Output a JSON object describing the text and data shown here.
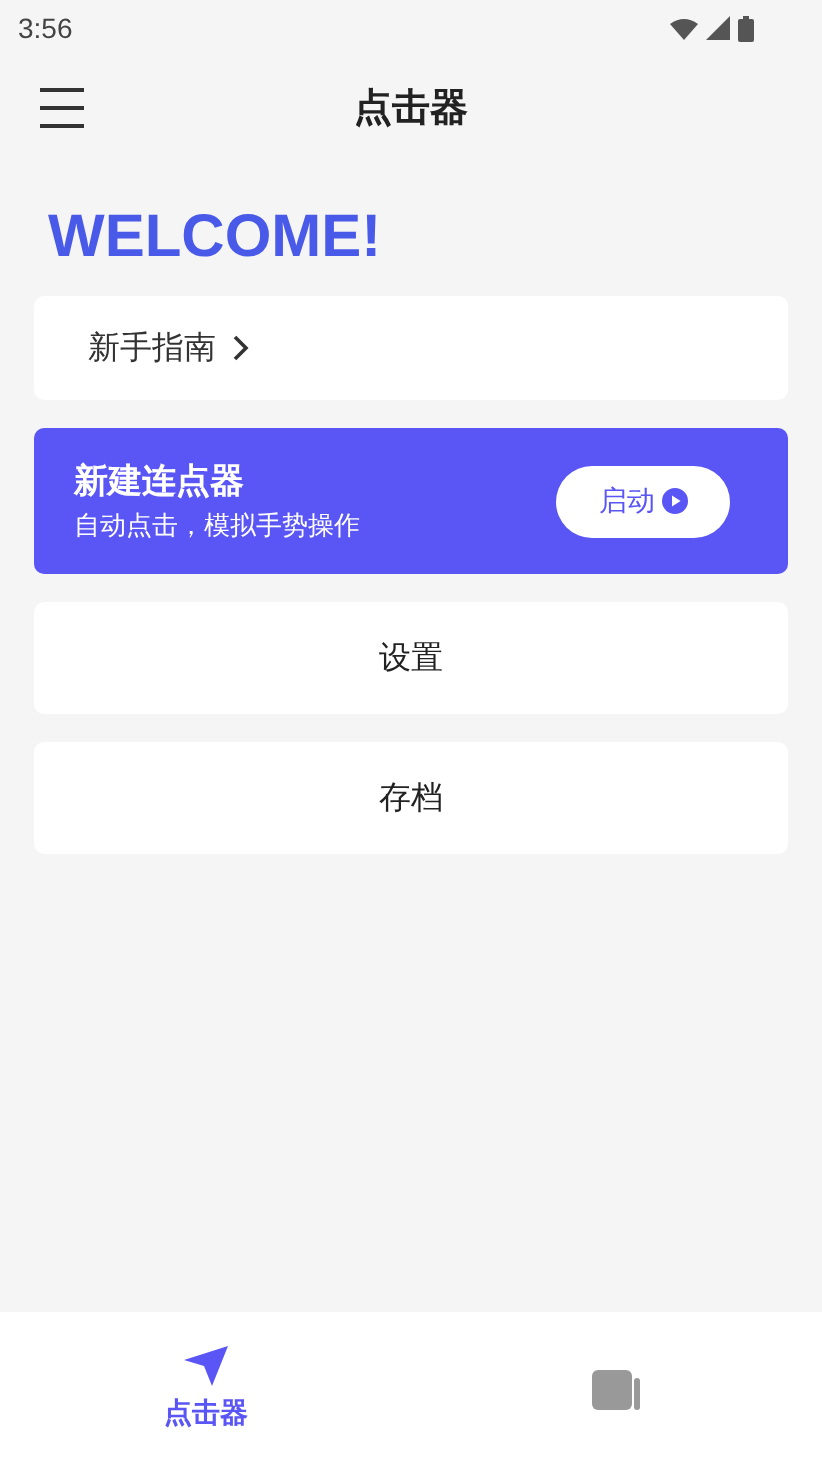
{
  "status_bar": {
    "time": "3:56"
  },
  "app_bar": {
    "title": "点击器"
  },
  "welcome": "WELCOME!",
  "guide": {
    "label": "新手指南"
  },
  "clicker_card": {
    "title": "新建连点器",
    "subtitle": "自动点击，模拟手势操作",
    "button": "启动"
  },
  "menu_items": [
    "设置",
    "存档"
  ],
  "bottom_nav": [
    {
      "label": "点击器",
      "selected": true
    },
    {
      "selected": false
    }
  ]
}
